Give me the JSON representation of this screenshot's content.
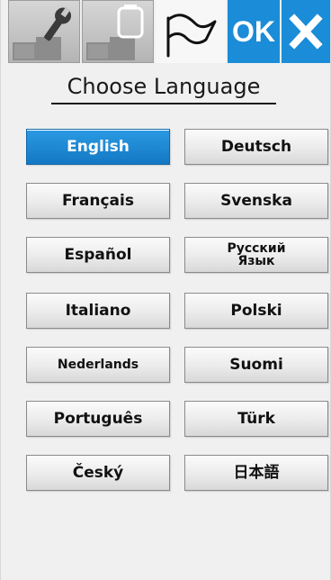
{
  "toolbar": {
    "tabs": [
      {
        "name": "settings",
        "icon": "wrench-icon"
      },
      {
        "name": "embroidery",
        "icon": "embroidery-frame-icon"
      },
      {
        "name": "language",
        "icon": "flag-icon",
        "active": true
      }
    ],
    "ok_label": "OK",
    "close_icon": "close-x-icon"
  },
  "heading": {
    "title": "Choose Language"
  },
  "languages": [
    {
      "label": "English",
      "selected": true
    },
    {
      "label": "Deutsch"
    },
    {
      "label": "Français"
    },
    {
      "label": "Svenska"
    },
    {
      "label": "Español"
    },
    {
      "label": "Русский Язык"
    },
    {
      "label": "Italiano"
    },
    {
      "label": "Polski"
    },
    {
      "label": "Nederlands"
    },
    {
      "label": "Suomi"
    },
    {
      "label": "Português"
    },
    {
      "label": "Türk"
    },
    {
      "label": "Český"
    },
    {
      "label": "日本語"
    }
  ],
  "colors": {
    "accent": "#1a8cd8",
    "selected_button": "#1a8cd8",
    "background": "#f0f0f0",
    "tab_inactive": "#c4c4c4"
  }
}
